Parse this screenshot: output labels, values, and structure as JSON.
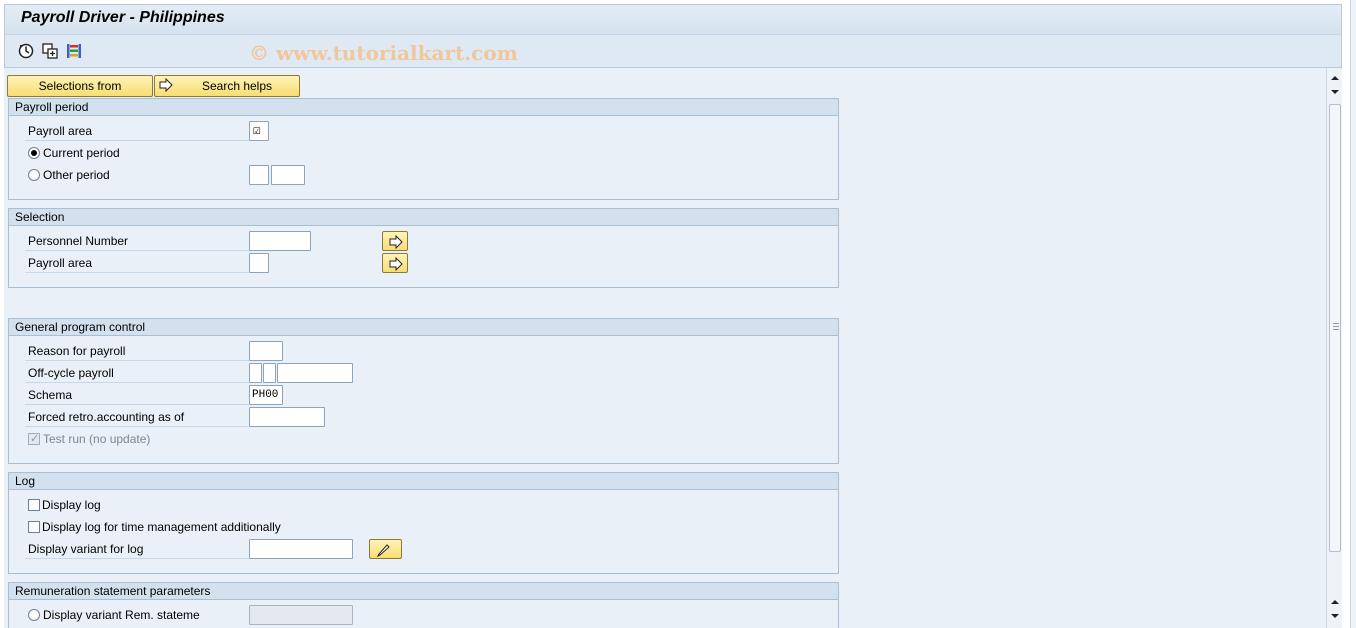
{
  "window": {
    "title": "Payroll Driver - Philippines",
    "watermark": "© www.tutorialkart.com"
  },
  "toolbar": {
    "icons": [
      "execute-icon",
      "variant-icon",
      "selection-options-icon"
    ],
    "selections_from_label": "Selections from",
    "search_helps_label": "Search helps"
  },
  "payroll_period": {
    "header": "Payroll period",
    "payroll_area_label": "Payroll area",
    "payroll_area_checked": true,
    "current_period_label": "Current period",
    "current_period_selected": true,
    "other_period_label": "Other period",
    "other_period_value_1": "",
    "other_period_value_2": ""
  },
  "selection": {
    "header": "Selection",
    "personnel_number_label": "Personnel Number",
    "personnel_number_value": "",
    "payroll_area_label": "Payroll area",
    "payroll_area_value": ""
  },
  "general": {
    "header": "General program control",
    "reason_label": "Reason for payroll",
    "reason_value": "",
    "offcycle_label": "Off-cycle payroll",
    "schema_label": "Schema",
    "schema_value": "PH00",
    "forced_retro_label": "Forced retro.accounting as of",
    "forced_retro_value": "",
    "test_run_label": "Test run (no update)",
    "test_run_checked": true
  },
  "log": {
    "header": "Log",
    "display_log_label": "Display log",
    "display_log_tm_label": "Display log for time management additionally",
    "display_variant_label": "Display variant for log",
    "display_variant_value": ""
  },
  "remuneration": {
    "header": "Remuneration statement parameters",
    "display_variant_label": "Display variant Rem. stateme",
    "display_variant_value": ""
  }
}
